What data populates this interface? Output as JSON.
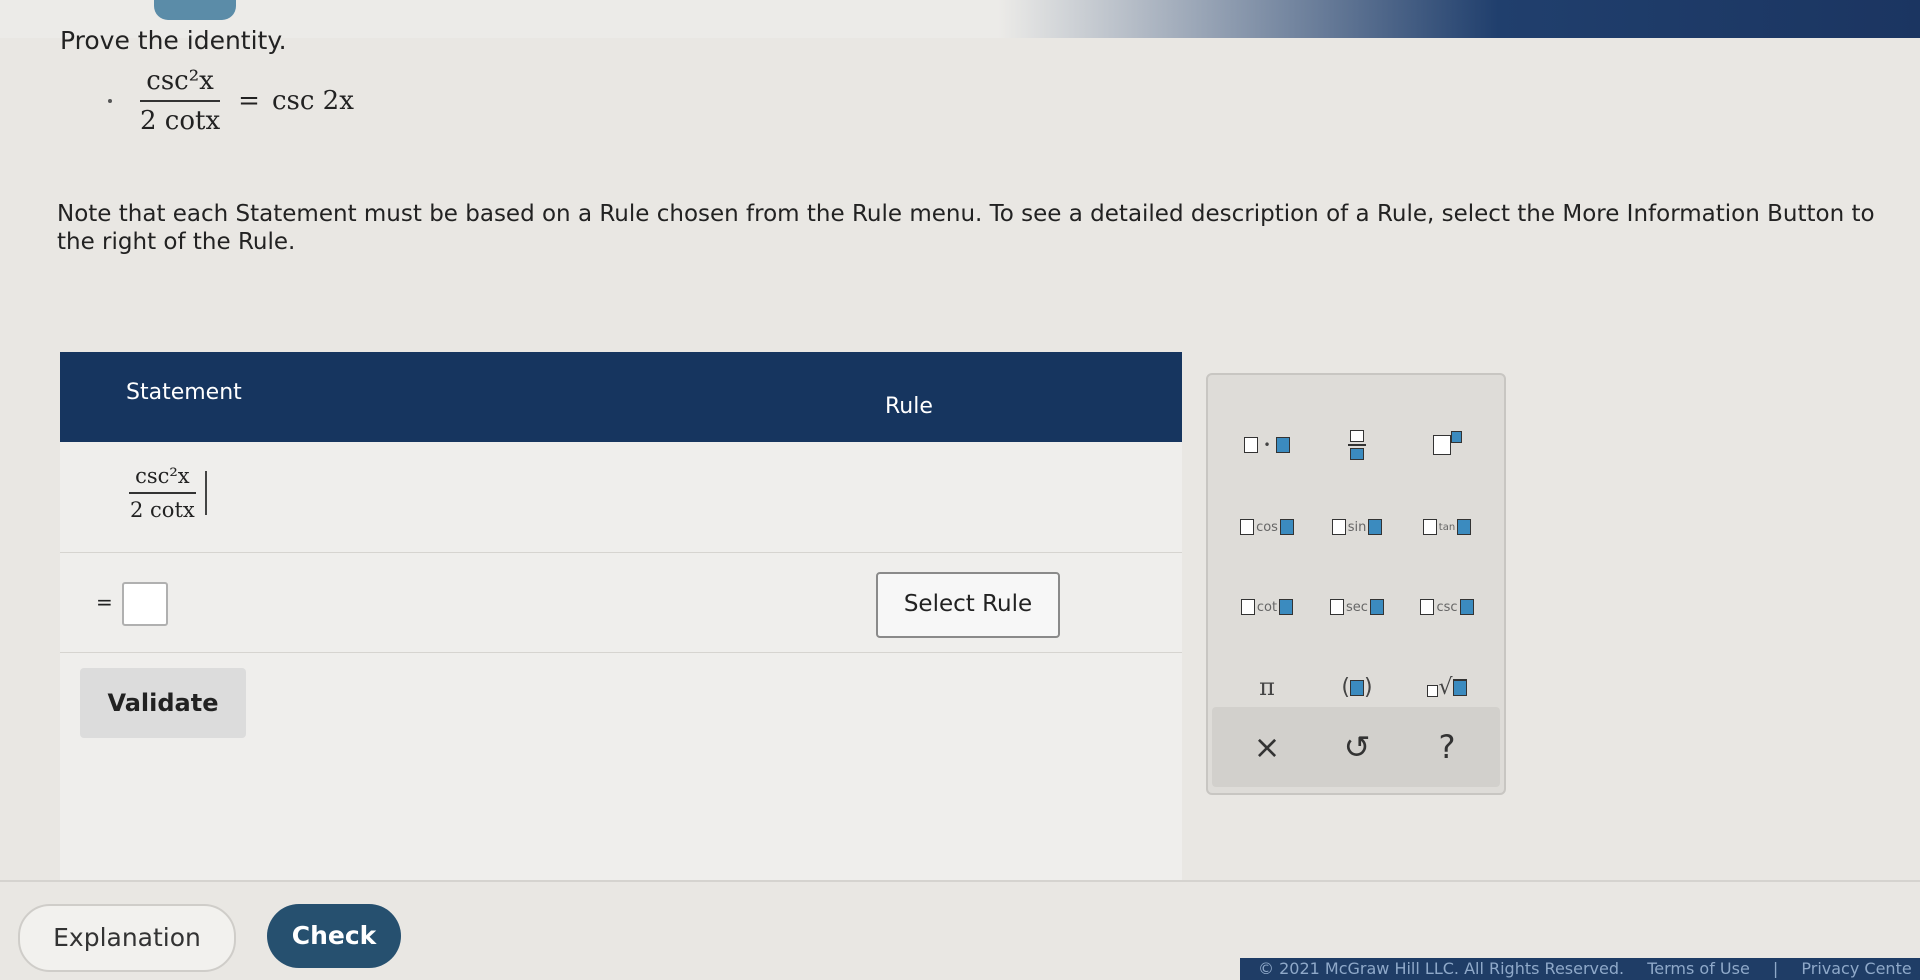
{
  "prompt": "Prove the identity.",
  "identity": {
    "numerator": "csc²x",
    "denominator": "2 cotx",
    "equals": "=",
    "rhs": "csc 2x"
  },
  "note": "Note that each Statement must be based on a Rule chosen from the Rule menu. To see a detailed description of a Rule, select the More Information Button to the right of the Rule.",
  "table": {
    "header_statement": "Statement",
    "header_rule": "Rule",
    "row1": {
      "numerator": "csc²x",
      "denominator": "2 cotx"
    },
    "row2": {
      "equals": "=",
      "select_rule": "Select Rule"
    },
    "validate": "Validate"
  },
  "palette": {
    "times": "×",
    "undo": "↺",
    "help": "?",
    "pi": "π",
    "trig": [
      "cos",
      "sin",
      "tan",
      "cot",
      "sec",
      "csc"
    ]
  },
  "footer": {
    "explanation": "Explanation",
    "check": "Check",
    "copyright": "© 2021 McGraw Hill LLC. All Rights Reserved.",
    "terms": "Terms of Use",
    "separator": "|",
    "privacy": "Privacy Cente"
  },
  "colors": {
    "header": "#16355f",
    "check_button": "#26506f",
    "accent": "#3b8bbf"
  }
}
